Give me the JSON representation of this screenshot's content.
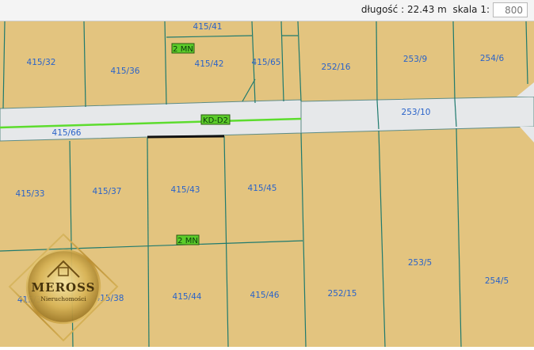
{
  "toolbar": {
    "measure_label": "długość :",
    "measure_value": "22.43 m",
    "scale_label": "skala 1:",
    "scale_value": "800"
  },
  "parcels": {
    "p415_41": "415/41",
    "p415_32": "415/32",
    "p415_36": "415/36",
    "p415_42": "415/42",
    "p415_65": "415/65",
    "p252_16": "252/16",
    "p253_9": "253/9",
    "p254_6": "254/6",
    "p415_66": "415/66",
    "p253_10": "253/10",
    "p415_33": "415/33",
    "p415_37": "415/37",
    "p415_43": "415/43",
    "p415_45": "415/45",
    "p253_5": "253/5",
    "p254_5": "254/5",
    "p415_3x": "415/3",
    "p415_38": "415/38",
    "p415_44": "415/44",
    "p415_46": "415/46",
    "p252_15": "252/15"
  },
  "zones": {
    "zone_top": "2 MN",
    "road": "KD-D2",
    "zone_bottom": "2 MN"
  },
  "watermark": {
    "brand": "MEROSS",
    "tagline": "Nieruchomości"
  },
  "colors": {
    "parcel_fill": "#e3c47f",
    "road_fill": "#e6e8ea",
    "boundary": "#1f7a6e",
    "zone_badge": "#5ccc2a",
    "road_line": "#5ddc2e",
    "parcel_label": "#2a63c9",
    "gold": "#c9a23e"
  }
}
